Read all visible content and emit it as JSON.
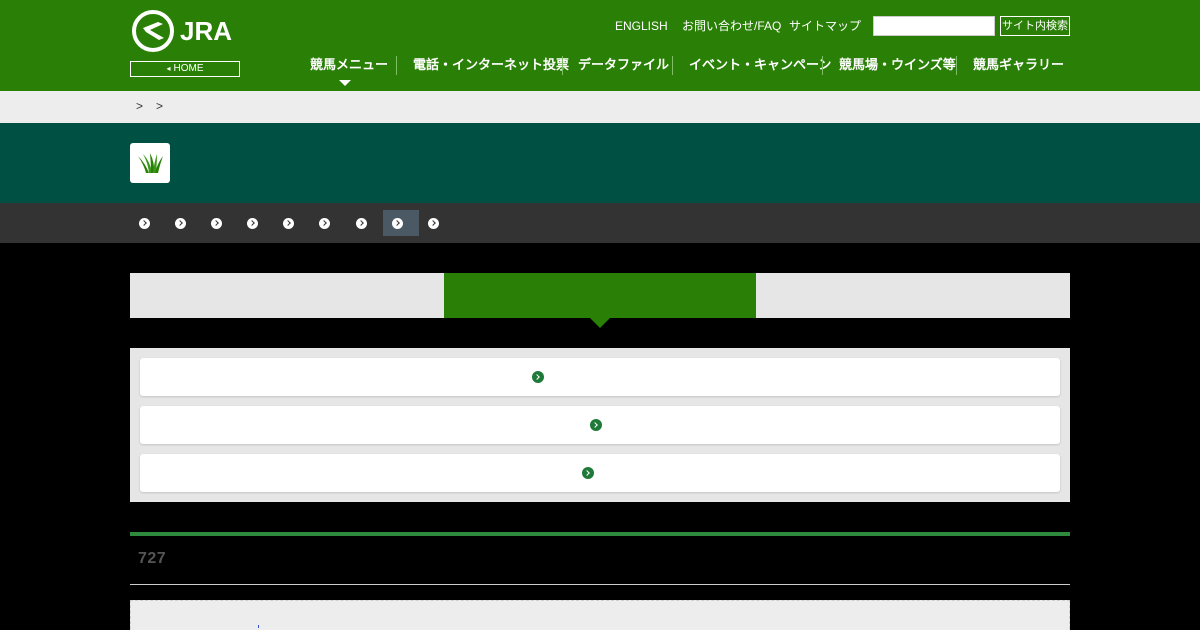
{
  "header": {
    "logo_text": "JRA",
    "home_label": "HOME",
    "util_links": [
      "ENGLISH",
      "お問い合わせ/FAQ",
      "サイトマップ"
    ],
    "search_placeholder": "",
    "search_button": "サイト内検索",
    "gnav": [
      "競馬メニュー",
      "電話・インターネット投票",
      "データファイル",
      "イベント・キャンペーン",
      "競馬場・ウインズ等",
      "競馬ギャラリー"
    ],
    "active_gnav": "競馬メニュー"
  },
  "breadcrumb": {
    "separators": [
      ">",
      ">"
    ]
  },
  "subnav": {
    "item_count": 9,
    "active_index": 7
  },
  "section": {
    "number": "727"
  },
  "colors": {
    "brand_green": "#2a8006",
    "title_band": "#005043",
    "subnav_bg": "#333333",
    "link_dot": "#1f7a3a"
  }
}
